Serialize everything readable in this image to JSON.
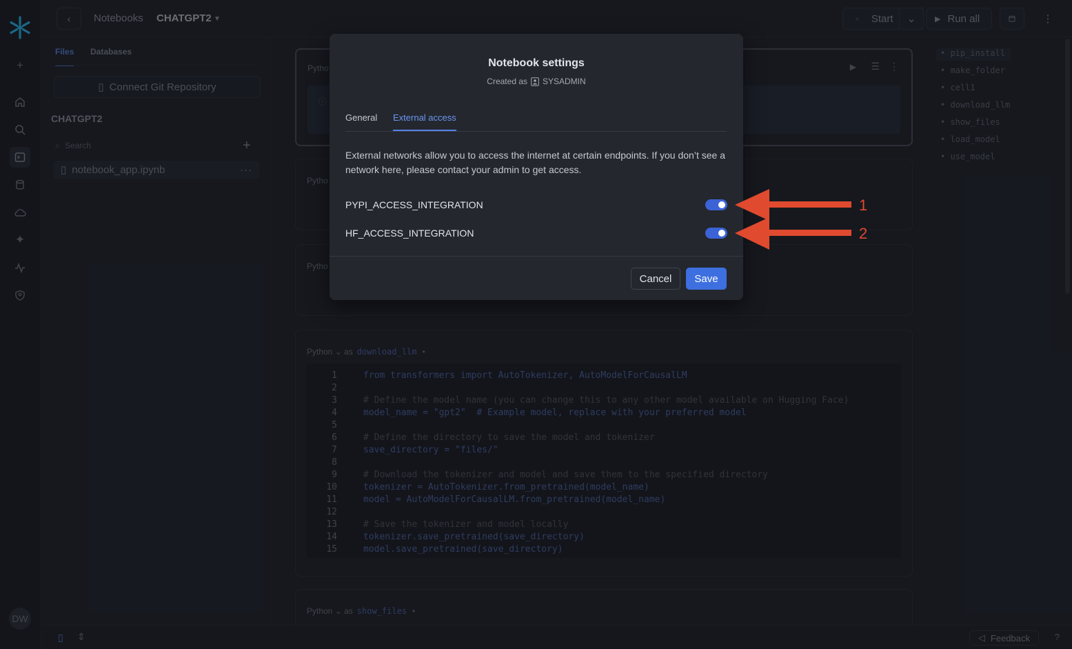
{
  "topbar": {
    "breadcrumb": "Notebooks",
    "notebook_title": "CHATGPT2",
    "start_label": "Start",
    "run_all_label": "Run all"
  },
  "files_panel": {
    "tabs": [
      "Files",
      "Databases"
    ],
    "connect_git_label": "Connect Git Repository",
    "project_name": "CHATGPT2",
    "search_placeholder": "Search",
    "file_name": "notebook_app.ipynb"
  },
  "cells": [
    {
      "lang": "Python",
      "name": "download_llm"
    },
    {
      "lang": "Python",
      "name": "show_files"
    }
  ],
  "collapsed_cell_labels": [
    "Pytho",
    "Pytho",
    "Pytho"
  ],
  "code_lines": [
    {
      "n": "1",
      "html_key": "l1"
    },
    {
      "n": "2"
    },
    {
      "n": "3"
    },
    {
      "n": "4"
    },
    {
      "n": "5"
    },
    {
      "n": "6"
    },
    {
      "n": "7"
    },
    {
      "n": "8"
    },
    {
      "n": "9"
    },
    {
      "n": "10"
    },
    {
      "n": "11"
    },
    {
      "n": "12"
    },
    {
      "n": "13"
    },
    {
      "n": "14"
    },
    {
      "n": "15"
    }
  ],
  "code_text": {
    "l1": "from transformers import AutoTokenizer, AutoModelForCausalLM",
    "l3": "# Define the model name (you can change this to any other model available on Hugging Face)",
    "l4": "model_name = \"gpt2\"  # Example model, replace with your preferred model",
    "l6": "# Define the directory to save the model and tokenizer",
    "l7": "save_directory = \"files/\"",
    "l9": "# Download the tokenizer and model and save them to the specified directory",
    "l10": "tokenizer = AutoTokenizer.from_pretrained(model_name)",
    "l11": "model = AutoModelForCausalLM.from_pretrained(model_name)",
    "l13": "# Save the tokenizer and model locally",
    "l14": "tokenizer.save_pretrained(save_directory)",
    "l15": "model.save_pretrained(save_directory)"
  },
  "outline": [
    "pip_install",
    "make_folder",
    "cell1",
    "download_llm",
    "show_files",
    "load_model",
    "use_model"
  ],
  "bottombar": {
    "feedback_label": "Feedback"
  },
  "avatar_initials": "DW",
  "modal": {
    "title": "Notebook settings",
    "created_as_label": "Created as",
    "role": "SYSADMIN",
    "tabs": [
      "General",
      "External access"
    ],
    "active_tab": "External access",
    "description": "External networks allow you to access the internet at certain endpoints. If you don’t see a network here, please contact your admin to get access.",
    "integrations": [
      {
        "name": "PYPI_ACCESS_INTEGRATION",
        "enabled": true
      },
      {
        "name": "HF_ACCESS_INTEGRATION",
        "enabled": true
      }
    ],
    "cancel_label": "Cancel",
    "save_label": "Save"
  },
  "annotations": [
    "1",
    "2"
  ],
  "colors": {
    "accent": "#3d6fe0",
    "toggle_on": "#3b63d6",
    "annotation": "#e04a2f"
  }
}
